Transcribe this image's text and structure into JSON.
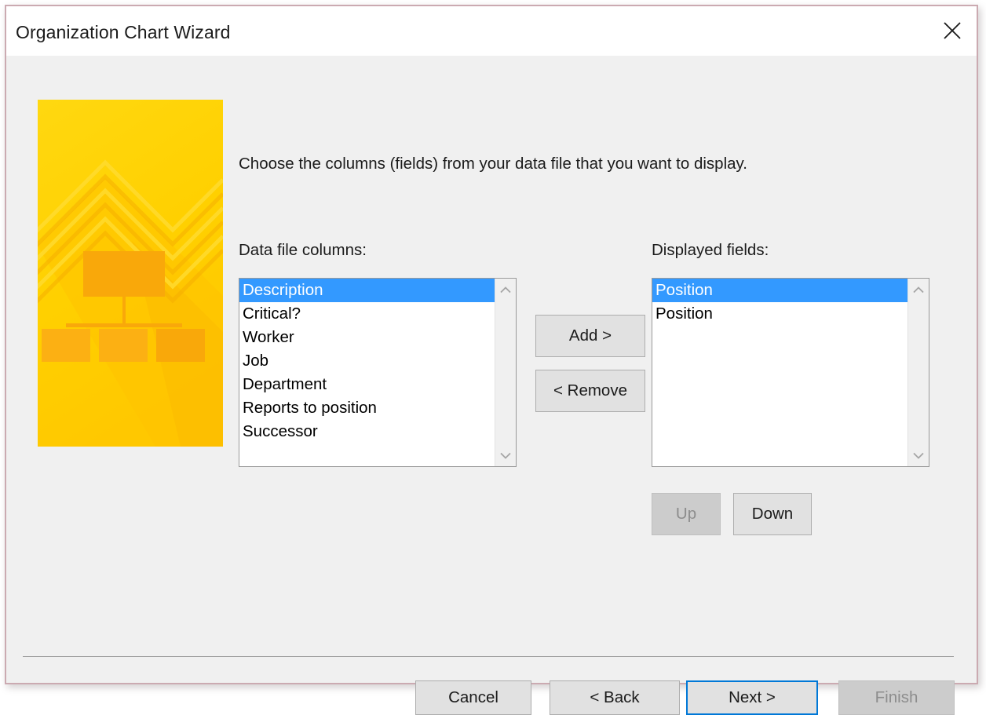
{
  "window": {
    "title": "Organization Chart Wizard",
    "close_icon": "close-icon",
    "border_color": "#cbaab1",
    "background_color": "#f0f0f0",
    "titlebar_color": "#ffffff"
  },
  "graphic": {
    "alt": "org-chart-illustration",
    "base_color": "#ffd200",
    "accent_color": "#f9a80a",
    "highlight_color": "#ffdd33"
  },
  "main": {
    "prompt": "Choose the columns (fields) from your data file that you want to display.",
    "left_list": {
      "label": "Data file columns:",
      "items": [
        {
          "text": "Description",
          "selected": true
        },
        {
          "text": "Critical?",
          "selected": false
        },
        {
          "text": "Worker",
          "selected": false
        },
        {
          "text": "Job",
          "selected": false
        },
        {
          "text": "Department",
          "selected": false
        },
        {
          "text": "Reports to position",
          "selected": false
        },
        {
          "text": "Successor",
          "selected": false
        }
      ]
    },
    "right_list": {
      "label": "Displayed fields:",
      "items": [
        {
          "text": "Position",
          "selected": true
        },
        {
          "text": "Position",
          "selected": false
        }
      ]
    },
    "transfer_buttons": {
      "add": "Add >",
      "remove": "< Remove"
    },
    "order_buttons": {
      "up": "Up",
      "up_enabled": false,
      "down": "Down",
      "down_enabled": true
    }
  },
  "footer": {
    "cancel": "Cancel",
    "back": "< Back",
    "next": "Next >",
    "next_focused": true,
    "finish": "Finish",
    "finish_enabled": false
  },
  "colors": {
    "selection_blue": "#3399ff",
    "focus_blue": "#0078d7",
    "button_face": "#e1e1e1",
    "disabled_face": "#cccccc",
    "disabled_text": "#8d8d8d"
  }
}
